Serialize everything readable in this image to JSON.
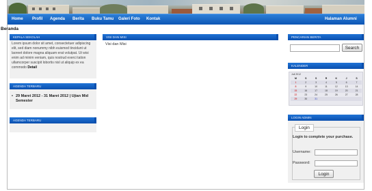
{
  "nav": {
    "items": [
      "Home",
      "Profil",
      "Agenda",
      "Berita",
      "Buku Tamu",
      "Galeri Foto",
      "Kontak"
    ],
    "right": "Halaman Alumni"
  },
  "breadcrumb": "Beranda",
  "kepala": {
    "title": "KEPALA SEKOLAH",
    "text": "Lorem ipsum dolor sit amet, consectetuer adipiscing elit, sed diam nonummy nibh euismod tincidunt ut laoreet dolore magna aliquam erat volutpat. Ut wisi enim ad minim veniam, quis nostrud exerci tation ullamcorper suscipit lobortis nisl ut aliquip ex ea commodo",
    "more": "Detail"
  },
  "agenda": {
    "title": "AGENDA TERBARU",
    "items": [
      "29 Maret 2012 - 31 Maret 2012 | Ujian Mid Semester"
    ]
  },
  "agenda2": {
    "title": "AGENDA TERBARU"
  },
  "visi": {
    "title": "VISI DAN MISI",
    "text": "Visi dan Misi"
  },
  "search": {
    "title": "PENCARIAN BERITA",
    "button": "Search",
    "value": ""
  },
  "calendar": {
    "title": "KALENDER",
    "month": "Juli 2012",
    "days": [
      "M",
      "S",
      "S",
      "R",
      "K",
      "J",
      "S"
    ],
    "weeks": [
      [
        "1",
        "2",
        "3",
        "4",
        "5",
        "6",
        "7"
      ],
      [
        "8",
        "9",
        "10",
        "11",
        "12",
        "13",
        "14"
      ],
      [
        "15",
        "16",
        "17",
        "18",
        "19",
        "20",
        "21"
      ],
      [
        "22",
        "23",
        "24",
        "25",
        "26",
        "27",
        "28"
      ],
      [
        "29",
        "30",
        "31",
        "",
        "",
        "",
        ""
      ]
    ]
  },
  "login": {
    "title": "LOGIN ADMIN",
    "legend": "Login",
    "message": "Login to complete your purchase.",
    "username_label": "Username:",
    "password_label": "Password:",
    "username_value": "",
    "password_value": "",
    "button": "Login"
  },
  "colors": {
    "nav": "#0d55b4",
    "panel": "#f0f0f0",
    "accent": "#1f73d6"
  }
}
